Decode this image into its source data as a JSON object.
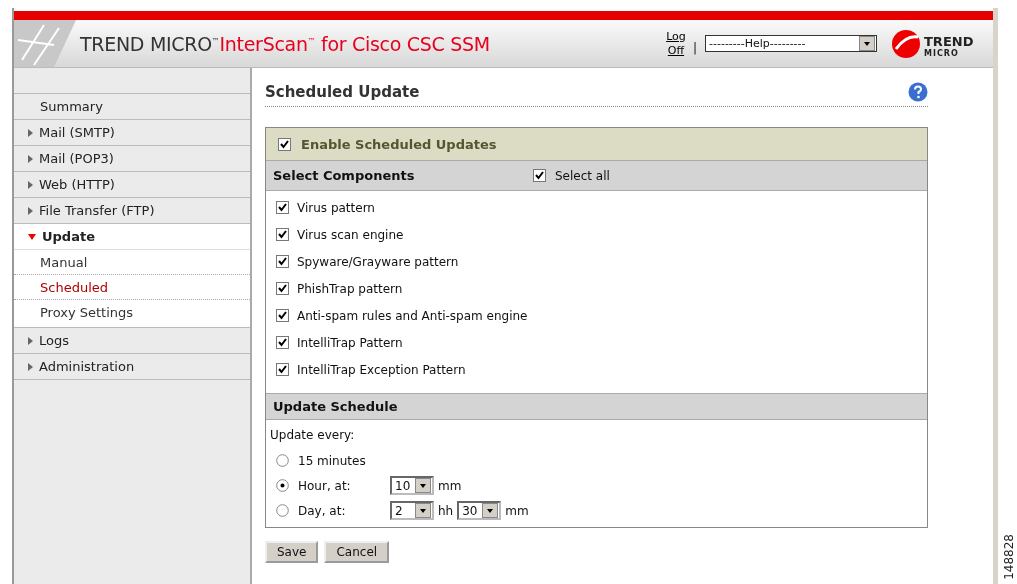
{
  "header": {
    "brand": "TREND MICRO$^{™}$",
    "product": "InterScan$^{™}$ for Cisco CSC SSM",
    "logout": "Log Off",
    "separator": "|",
    "help_select": "---------Help---------",
    "logo_top": "TREND",
    "logo_bottom": "MICRO"
  },
  "sidebar": {
    "items": [
      {
        "kind": "link",
        "label": "Summary"
      },
      {
        "kind": "group",
        "label": "Mail (SMTP)",
        "expanded": false
      },
      {
        "kind": "group",
        "label": "Mail (POP3)",
        "expanded": false
      },
      {
        "kind": "group",
        "label": "Web (HTTP)",
        "expanded": false
      },
      {
        "kind": "group",
        "label": "File Transfer (FTP)",
        "expanded": false
      },
      {
        "kind": "group",
        "label": "Update",
        "expanded": true,
        "children": [
          {
            "label": "Manual",
            "selected": false
          },
          {
            "label": "Scheduled",
            "selected": true
          },
          {
            "label": "Proxy Settings",
            "selected": false
          }
        ]
      },
      {
        "kind": "group",
        "label": "Logs",
        "expanded": false
      },
      {
        "kind": "group",
        "label": "Administration",
        "expanded": false
      }
    ]
  },
  "content": {
    "title": "Scheduled Update",
    "enable": {
      "label": "Enable Scheduled Updates",
      "checked": true
    },
    "components": {
      "heading": "Select Components",
      "select_all": {
        "label": "Select all",
        "checked": true
      },
      "items": [
        {
          "label": "Virus pattern",
          "checked": true
        },
        {
          "label": "Virus scan engine",
          "checked": true
        },
        {
          "label": "Spyware/Grayware pattern",
          "checked": true
        },
        {
          "label": "PhishTrap pattern",
          "checked": true
        },
        {
          "label": "Anti-spam rules and Anti-spam engine",
          "checked": true
        },
        {
          "label": "IntelliTrap Pattern",
          "checked": true
        },
        {
          "label": "IntelliTrap Exception Pattern",
          "checked": true
        }
      ]
    },
    "schedule": {
      "heading": "Update Schedule",
      "prompt": "Update every:",
      "options": [
        {
          "label": "15 minutes",
          "selected": false
        },
        {
          "label": "Hour, at:",
          "selected": true,
          "controls": [
            {
              "kind": "select",
              "value": "10"
            },
            {
              "kind": "unit",
              "text": "mm"
            }
          ]
        },
        {
          "label": "Day, at:",
          "selected": false,
          "controls": [
            {
              "kind": "select",
              "value": "2"
            },
            {
              "kind": "unit",
              "text": "hh"
            },
            {
              "kind": "select",
              "value": "30"
            },
            {
              "kind": "unit",
              "text": "mm"
            }
          ]
        }
      ]
    },
    "buttons": [
      "Save",
      "Cancel"
    ]
  },
  "figure_id": "148828"
}
